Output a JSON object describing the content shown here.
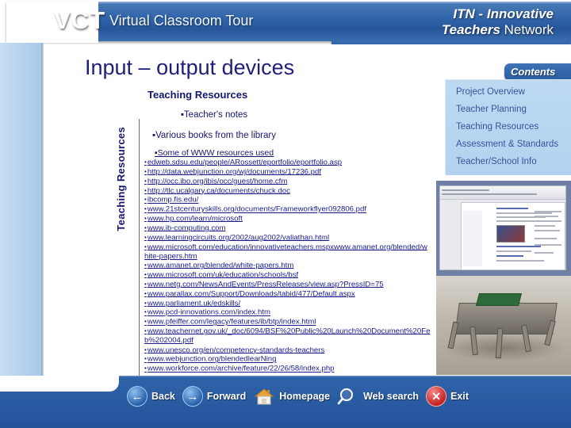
{
  "header": {
    "logo_main": "VCT",
    "logo_sub": "Virtual Classroom Tour",
    "brand_line1": "ITN - Innovative",
    "brand_line2_bold": "Teachers",
    "brand_line2_rest": " Network"
  },
  "slide": {
    "title": "Input – output devices",
    "section_label": "Teaching Resources",
    "side_label": "Teaching Resources",
    "bullets": [
      "▪Teacher's notes",
      "▪Various books from the library",
      "▪Some of WWW resources used"
    ],
    "urls": [
      "edweb.sdsu.edu/people/ARossett/eportfolio/eportfolio.asp",
      "http://data.webjunction.org/wj/documents/17236.pdf",
      "http://occ.ibo.org/ibis/occ/guest/home.cfm",
      "http://tlc.ucalgary.ca/documents/chuck.doc",
      "ibcomp.fis.edu/",
      "www.21stcenturyskills.org/documents/Frameworkflyer092806.pdf",
      "www.hp.com/learn/microsoft",
      "www.ib-computing.com",
      "www.learningcircuits.org/2002/aug2002/valiathan.html",
      "www.microsoft.com/education/innovativeteachers.mspxwww.amanet.org/blended/white-papers.htm",
      "www.amanet.org/blended/white-papers.htm",
      "www.microsoft.com/uk/education/schools/bsf",
      "www.netg.com/NewsAndEvents/PressReleases/view.asp?PressID=75",
      "www.parallax.com/Support/Downloads/tabid/477/Default.aspx",
      "www.parliament.uk/edskills/",
      "www.pcd-innovations.com/index.htm",
      "www.pfeiffer.com/legacy/features/ib/btp/index.html",
      "www.teachernet.gov.uk/_doc/6094/BSF%20Public%20Launch%20Document%20Feb%202004.pdf",
      "www.unesco.org/en/competency-standards-teachers",
      "www.webjunction.org/blendedlearNing",
      "www.workforce.com/archive/feature/22/26/58/index.php"
    ]
  },
  "contents": {
    "tab_label": "Contents",
    "items": [
      "Project Overview",
      "Teacher Planning",
      "Teaching  Resources",
      "Assessment & Standards",
      "Teacher/School Info"
    ]
  },
  "nav": {
    "items": [
      {
        "label": "Back",
        "icon": "arrow-left-icon",
        "glyph": "←",
        "style": "blue"
      },
      {
        "label": "Forward",
        "icon": "arrow-right-icon",
        "glyph": "→",
        "style": "blue"
      },
      {
        "label": "Homepage",
        "icon": "house-icon",
        "glyph": "",
        "style": "house"
      },
      {
        "label": "Web search",
        "icon": "magnifier-icon",
        "glyph": "",
        "style": "mag"
      },
      {
        "label": "Exit",
        "icon": "close-x-icon",
        "glyph": "✕",
        "style": "red"
      }
    ]
  },
  "thumbnails": {
    "browser_caption": "browser-screenshot-thumbnail",
    "robot_caption": "robot-photo-thumbnail"
  },
  "colors": {
    "header_blue": "#2f63a8",
    "panel_blue": "#b2d2ef",
    "title_navy": "#1f1f7a",
    "link_navy": "#1a1a8c"
  }
}
